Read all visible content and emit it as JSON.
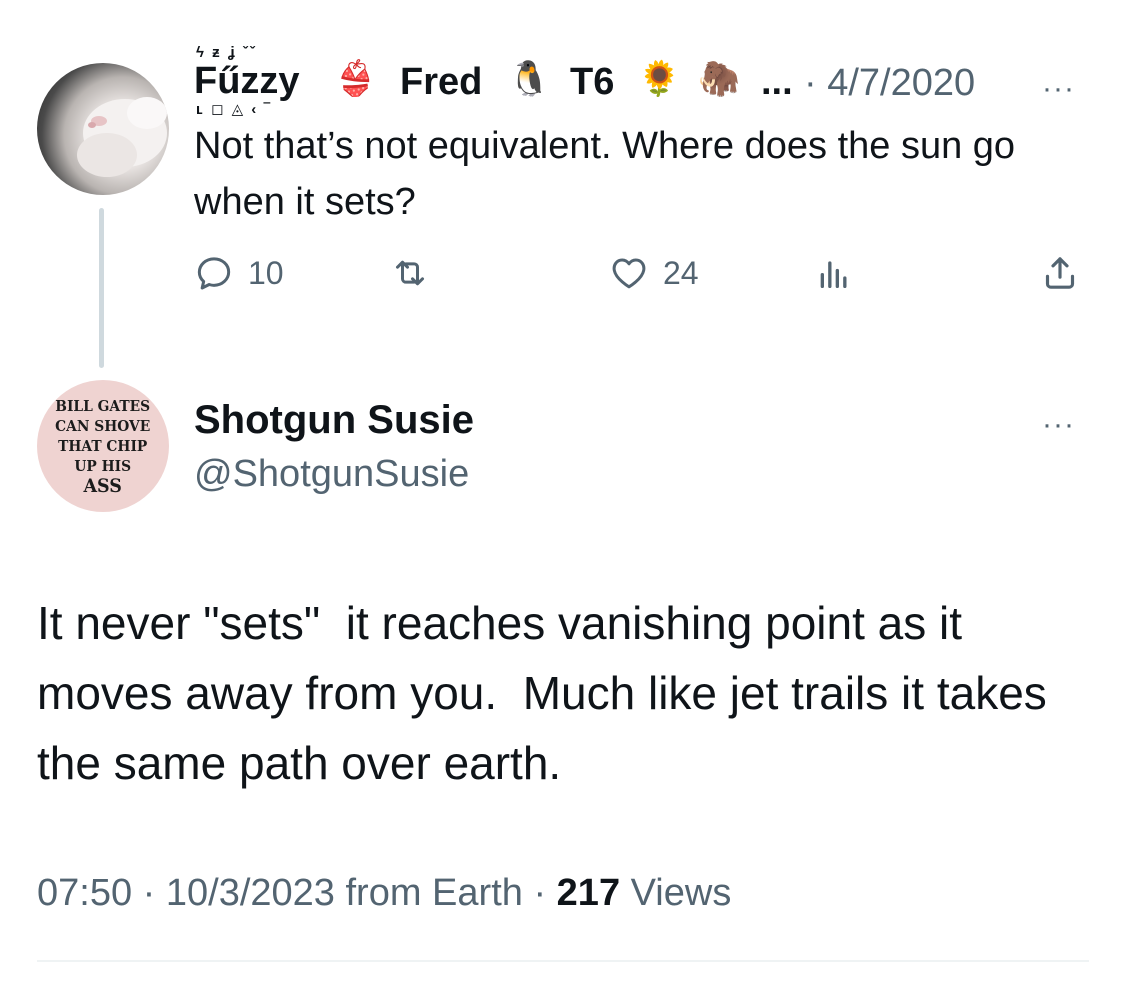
{
  "parent_tweet": {
    "display_name_part1": "Fűzzy",
    "display_name_glyphs_top": "ϟ ƶ ʝ ˇˇ",
    "display_name_glyphs_bottom": "ʟ ◻ ◬ ‹ ‾",
    "display_name_part2": "Fred",
    "display_name_part3": "T6",
    "name_truncation": "...",
    "emoji_1": "👙",
    "emoji_2": "🐧",
    "emoji_3": "🌻",
    "emoji_4": "🦣",
    "date": "· 4/7/2020",
    "more_label": "···",
    "text": "Not that’s not equivalent. Where does the sun go when it sets?",
    "reply_count": "10",
    "retweet_count": "",
    "like_count": "24",
    "views_icon": "analytics-icon",
    "share_icon": "share-icon"
  },
  "main_tweet": {
    "avatar_text": [
      "BILL GATES",
      "CAN SHOVE",
      "THAT CHIP",
      "UP HIS",
      "ASS"
    ],
    "author_name": "Shotgun Susie",
    "author_handle": "@ShotgunSusie",
    "more_label": "···",
    "text": "It never \"sets\"  it reaches vanishing point as it moves away from you.  Much like jet trails it takes the same path over earth.",
    "time": "07:50",
    "date": "10/3/2023",
    "source": "from Earth",
    "separator": "·",
    "views_count": "217",
    "views_label": "Views"
  },
  "colors": {
    "text_primary": "#0f1419",
    "text_secondary": "#536471",
    "thread_line": "#cfd9de",
    "divider": "#eff3f4"
  }
}
